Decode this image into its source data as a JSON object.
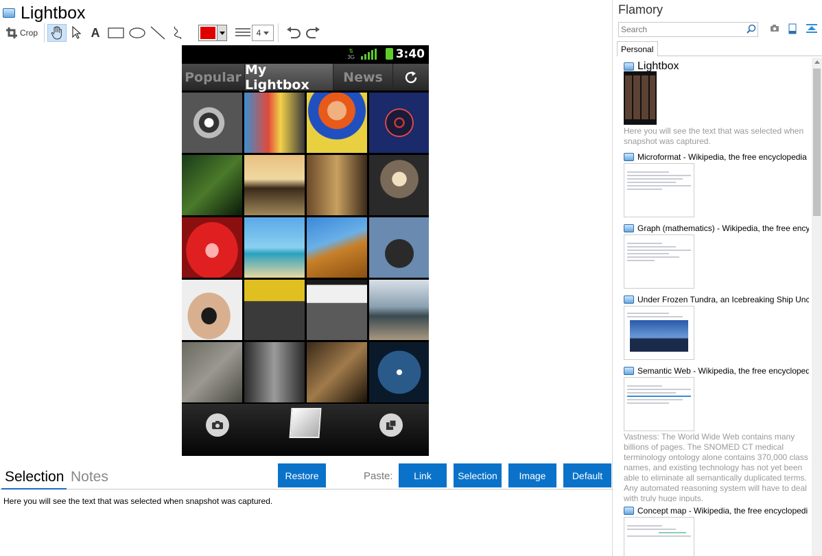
{
  "window": {
    "title": "Lightbox"
  },
  "toolbar": {
    "crop_label": "Crop",
    "line_width": "4",
    "color": "#e10000"
  },
  "phone": {
    "time": "3:40",
    "network": "3G",
    "tabs": [
      {
        "label": "Popular",
        "active": false
      },
      {
        "label": "My Lightbox",
        "active": true
      },
      {
        "label": "News",
        "active": false
      }
    ]
  },
  "bottom": {
    "tabs": [
      {
        "label": "Selection"
      },
      {
        "label": "Notes"
      }
    ],
    "restore_label": "Restore",
    "paste_label": "Paste:",
    "paste_buttons": [
      "Link",
      "Selection",
      "Image",
      "Default"
    ],
    "selection_text": "Here you will see the text that was selected when snapshot was captured."
  },
  "flamory": {
    "title": "Flamory",
    "search_placeholder": "Search",
    "tab_label": "Personal",
    "items": [
      {
        "title": "Lightbox",
        "note": "Here you will see the text that was selected when snapshot was captured."
      },
      {
        "title": "Microformat - Wikipedia, the free encyclopedia"
      },
      {
        "title": "Graph (mathematics) - Wikipedia, the free ency"
      },
      {
        "title": "Under Frozen Tundra, an Icebreaking Ship Unco"
      },
      {
        "title": "Semantic Web - Wikipedia, the free encycloped",
        "note": "Vastness: The World Wide Web contains many billions of pages. The SNOMED CT medical terminology ontology alone contains 370,000 class names, and existing technology has not yet been able to eliminate all semantically duplicated terms. Any automated reasoning system will have to deal with truly huge inputs."
      },
      {
        "title": "Concept map - Wikipedia, the free encyclopedi"
      }
    ]
  },
  "colors": {
    "accent": "#0a72c9",
    "selected_tool": "#cde3f7"
  }
}
